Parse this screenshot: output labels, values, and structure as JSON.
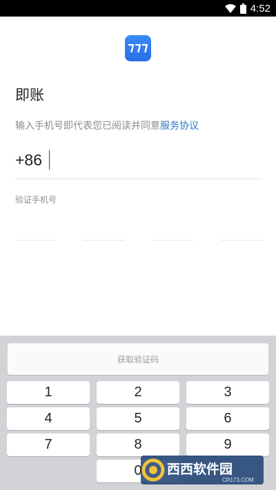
{
  "status_bar": {
    "time": "4:52"
  },
  "app": {
    "name": "即账",
    "logo_glyph": "777"
  },
  "agreement": {
    "prefix": "输入手机号即代表您已阅读并同意",
    "link": "服务协议"
  },
  "phone": {
    "country_code": "+86",
    "value": ""
  },
  "verify": {
    "label": "验证手机号"
  },
  "keyboard": {
    "get_code_label": "获取验证码",
    "keys": [
      "1",
      "2",
      "3",
      "4",
      "5",
      "6",
      "7",
      "8",
      "9",
      "0"
    ]
  },
  "watermark": {
    "brand": "西西软件园",
    "site": "CR173.COM"
  },
  "colors": {
    "accent": "#2d79c8",
    "logo": "#2a6ee6",
    "keyboard_bg": "#d1d3d6"
  }
}
